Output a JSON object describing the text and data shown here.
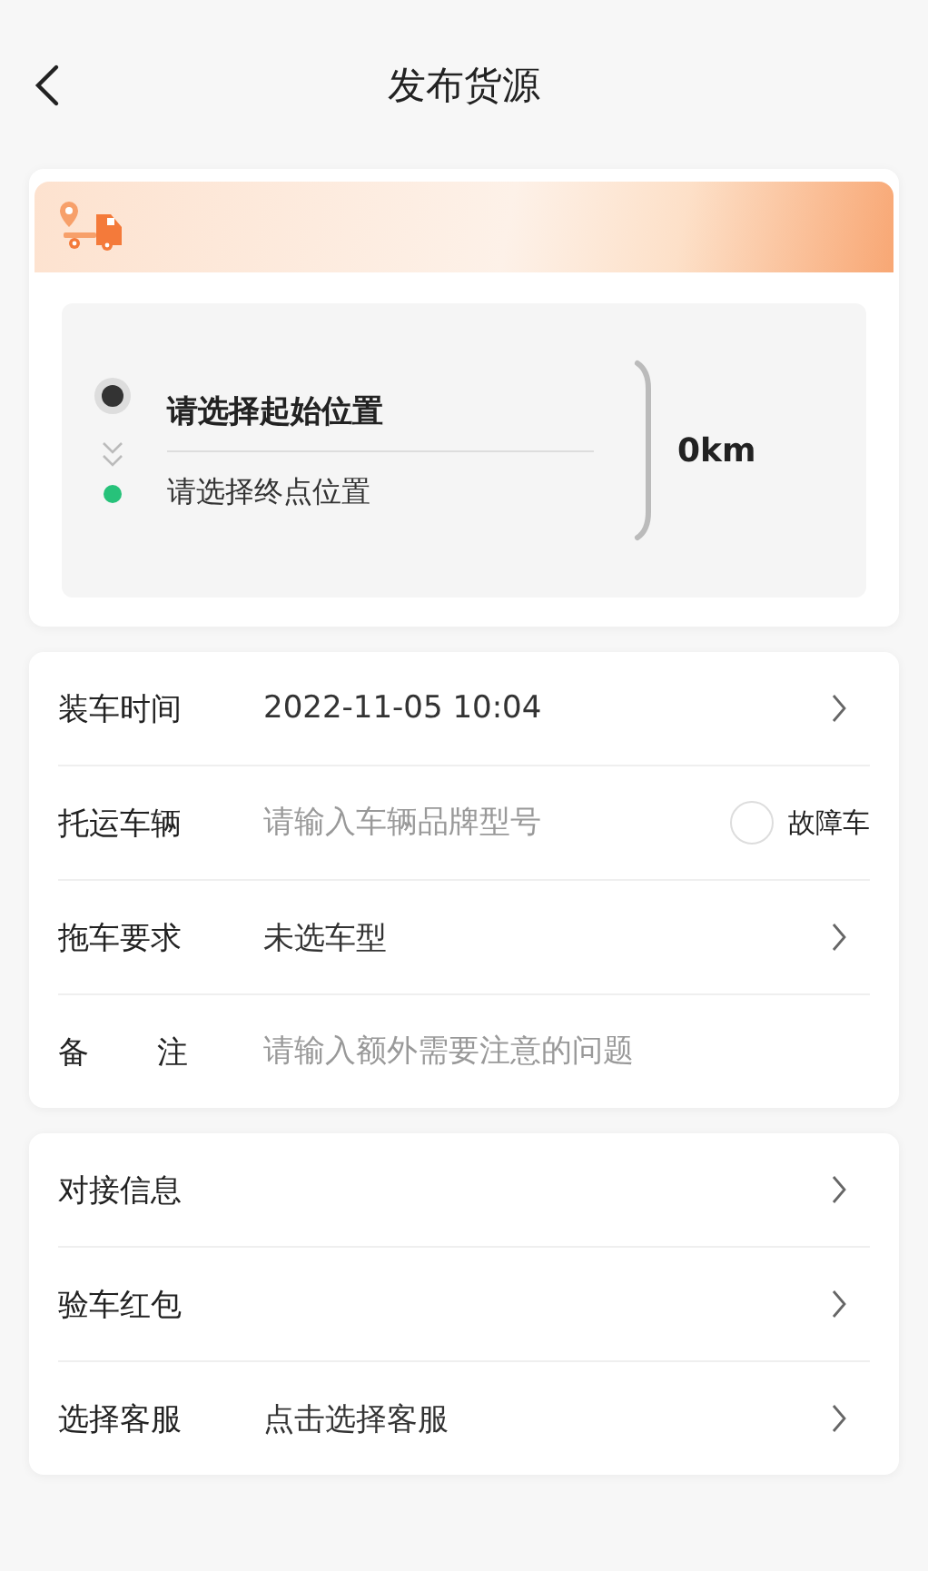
{
  "header": {
    "title": "发布货源"
  },
  "route": {
    "start": "请选择起始位置",
    "end": "请选择终点位置",
    "distance": "0km"
  },
  "details": [
    {
      "kind": "select",
      "label": "装车时间",
      "value": "2022-11-05 10:04"
    },
    {
      "kind": "input_check",
      "label": "托运车辆",
      "placeholder": "请输入车辆品牌型号",
      "check_label": "故障车",
      "checked": false
    },
    {
      "kind": "select",
      "label": "拖车要求",
      "value": "未选车型"
    },
    {
      "kind": "input",
      "label": "备 注",
      "placeholder": "请输入额外需要注意的问题"
    }
  ],
  "extras": [
    {
      "kind": "select",
      "label": "对接信息"
    },
    {
      "kind": "select",
      "label": "验车红包"
    },
    {
      "kind": "select",
      "label": "选择客服",
      "value": "点击选择客服"
    }
  ]
}
